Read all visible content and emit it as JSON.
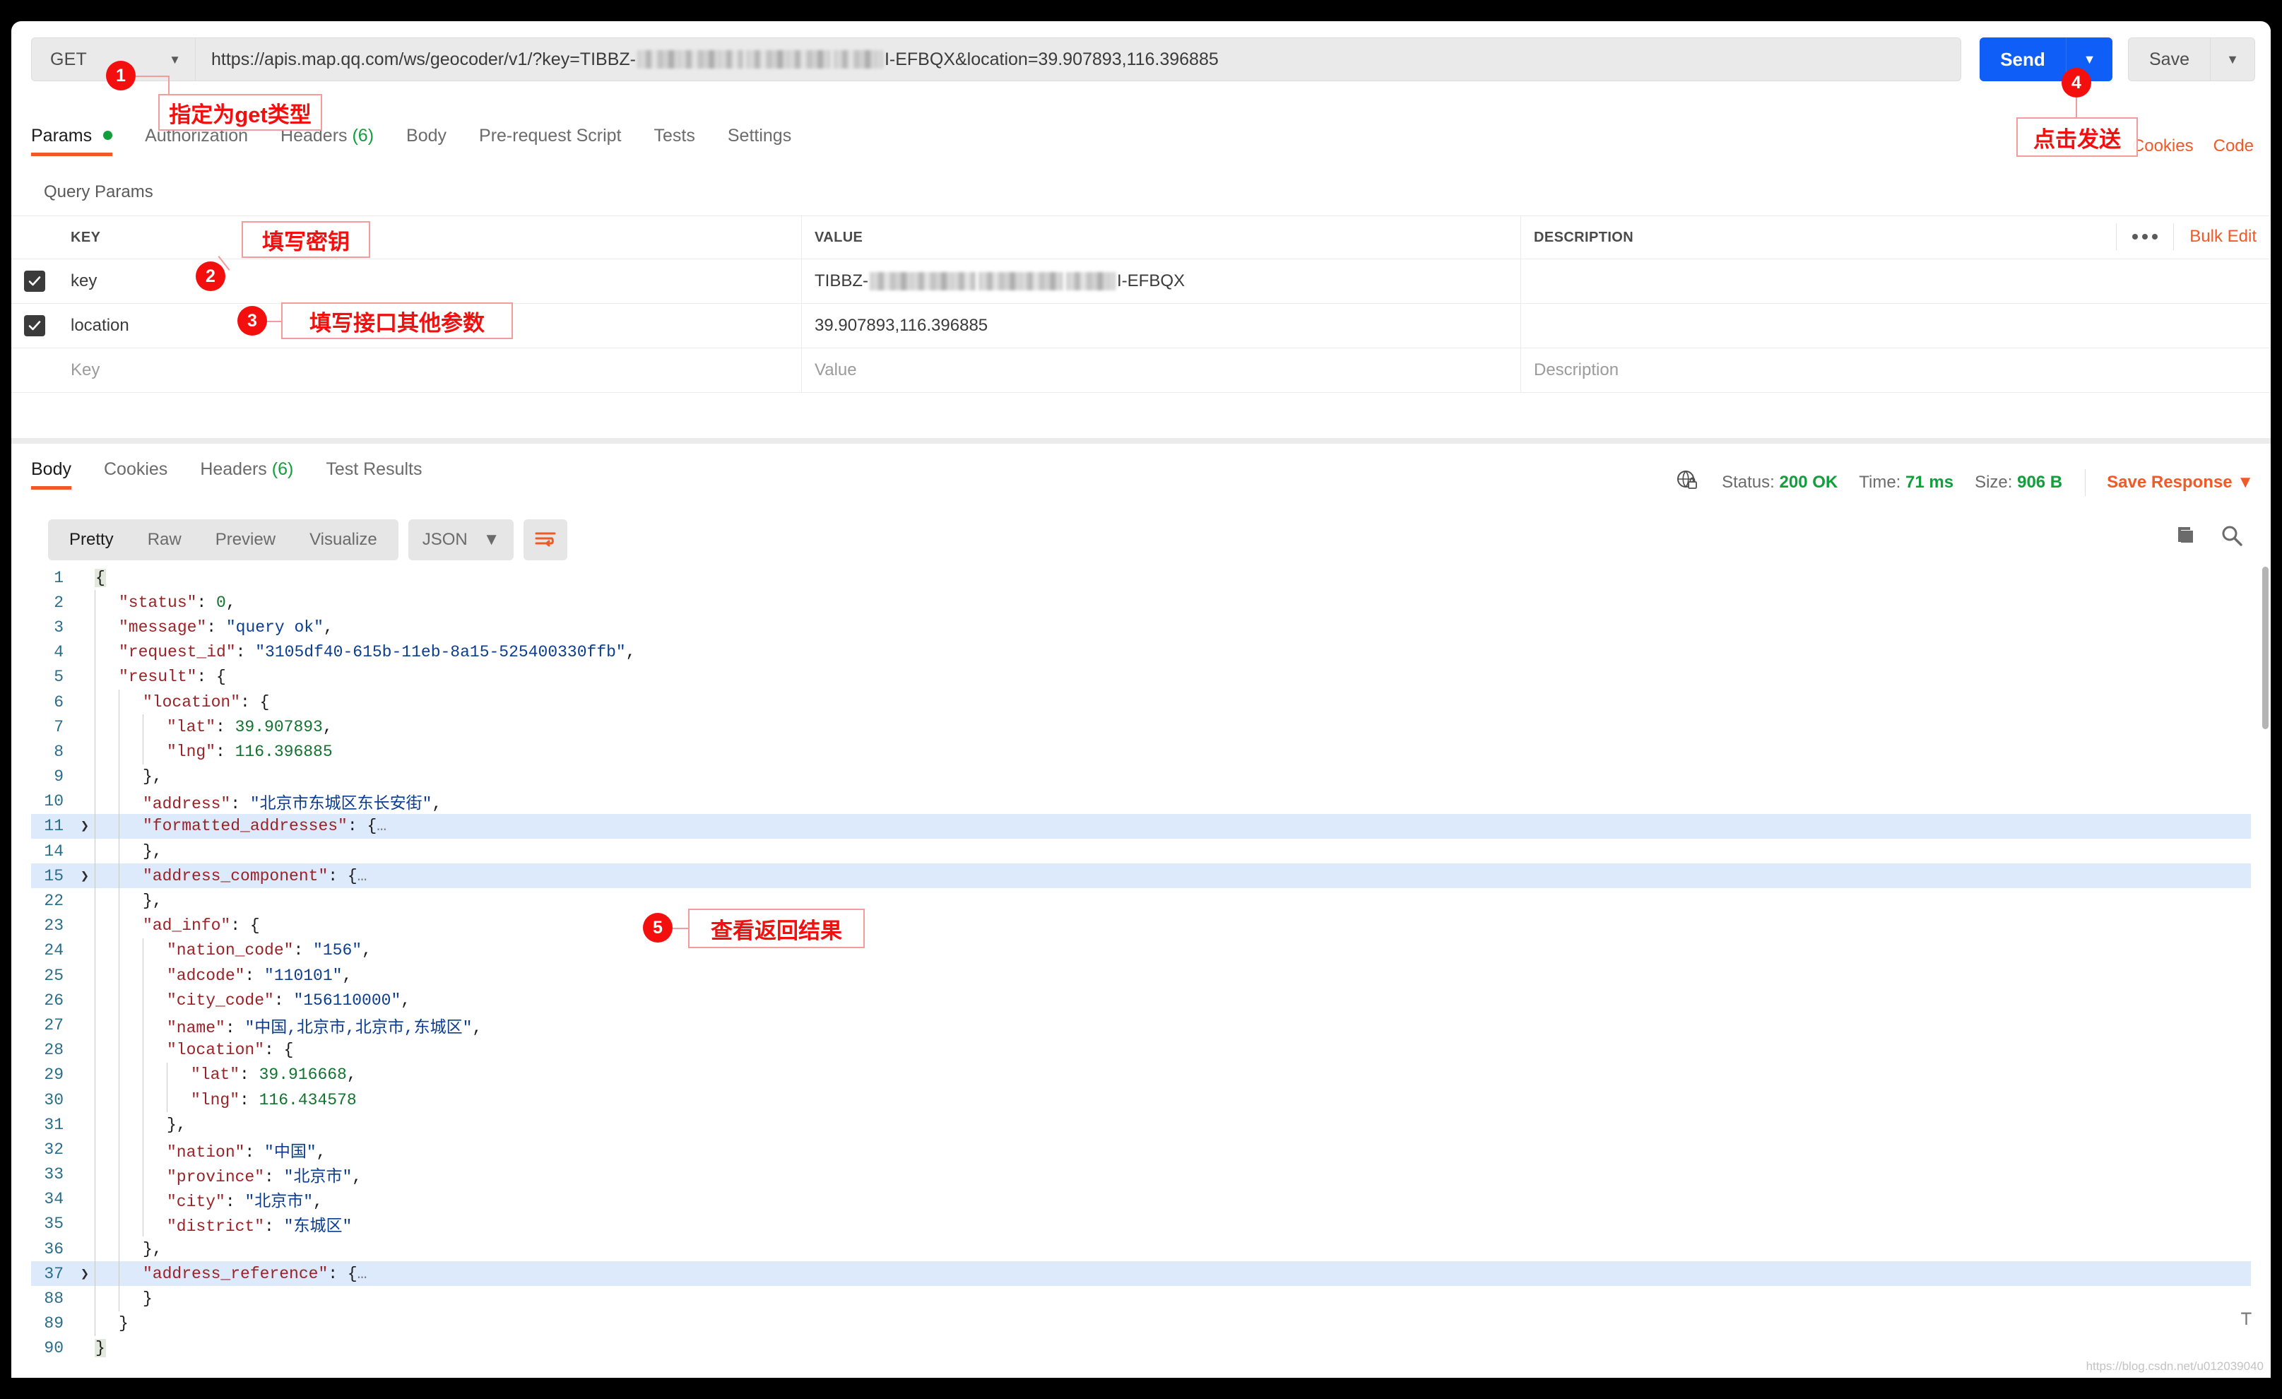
{
  "request": {
    "method": "GET",
    "url_prefix": "https://apis.map.qq.com/ws/geocoder/v1/?key=TIBBZ-",
    "url_suffix": "I-EFBQX&location=39.907893,116.396885",
    "send_label": "Send",
    "save_label": "Save",
    "tabs": [
      {
        "label": "Params",
        "active": true,
        "indicator": "dot"
      },
      {
        "label": "Authorization",
        "active": false
      },
      {
        "label": "Headers",
        "active": false,
        "count": "(6)"
      },
      {
        "label": "Body",
        "active": false
      },
      {
        "label": "Pre-request Script",
        "active": false
      },
      {
        "label": "Tests",
        "active": false
      },
      {
        "label": "Settings",
        "active": false
      }
    ],
    "right_links": [
      "Cookies",
      "Code"
    ]
  },
  "query_params": {
    "section_title": "Query Params",
    "columns": [
      "KEY",
      "VALUE",
      "DESCRIPTION"
    ],
    "rows": [
      {
        "checked": true,
        "key": "key",
        "value_prefix": "TIBBZ-",
        "value_suffix": "I-EFBQX",
        "redacted": true,
        "description": ""
      },
      {
        "checked": true,
        "key": "location",
        "value": "39.907893,116.396885",
        "description": ""
      }
    ],
    "placeholder_row": {
      "key": "Key",
      "value": "Value",
      "description": "Description"
    },
    "bulk_edit_label": "Bulk Edit"
  },
  "response": {
    "tabs": [
      {
        "label": "Body",
        "active": true
      },
      {
        "label": "Cookies",
        "active": false
      },
      {
        "label": "Headers",
        "active": false,
        "count": "(6)"
      },
      {
        "label": "Test Results",
        "active": false
      }
    ],
    "status_label": "Status:",
    "status_value": "200 OK",
    "time_label": "Time:",
    "time_value": "71 ms",
    "size_label": "Size:",
    "size_value": "906 B",
    "save_response_label": "Save Response",
    "view_modes": [
      {
        "label": "Pretty",
        "active": true
      },
      {
        "label": "Raw",
        "active": false
      },
      {
        "label": "Preview",
        "active": false
      },
      {
        "label": "Visualize",
        "active": false
      }
    ],
    "format": "JSON"
  },
  "code": {
    "lines": [
      {
        "n": "1",
        "indent": 0,
        "fold": "",
        "hl": false,
        "cur": true,
        "tokens": [
          {
            "t": "pun",
            "v": "{"
          }
        ]
      },
      {
        "n": "2",
        "indent": 1,
        "fold": "",
        "hl": false,
        "tokens": [
          {
            "t": "key",
            "v": "\"status\""
          },
          {
            "t": "pun",
            "v": ": "
          },
          {
            "t": "num",
            "v": "0"
          },
          {
            "t": "pun",
            "v": ","
          }
        ]
      },
      {
        "n": "3",
        "indent": 1,
        "fold": "",
        "hl": false,
        "tokens": [
          {
            "t": "key",
            "v": "\"message\""
          },
          {
            "t": "pun",
            "v": ": "
          },
          {
            "t": "str",
            "v": "\"query ok\""
          },
          {
            "t": "pun",
            "v": ","
          }
        ]
      },
      {
        "n": "4",
        "indent": 1,
        "fold": "",
        "hl": false,
        "tokens": [
          {
            "t": "key",
            "v": "\"request_id\""
          },
          {
            "t": "pun",
            "v": ": "
          },
          {
            "t": "str",
            "v": "\"3105df40-615b-11eb-8a15-525400330ffb\""
          },
          {
            "t": "pun",
            "v": ","
          }
        ]
      },
      {
        "n": "5",
        "indent": 1,
        "fold": "",
        "hl": false,
        "tokens": [
          {
            "t": "key",
            "v": "\"result\""
          },
          {
            "t": "pun",
            "v": ": {"
          }
        ]
      },
      {
        "n": "6",
        "indent": 2,
        "fold": "",
        "hl": false,
        "tokens": [
          {
            "t": "key",
            "v": "\"location\""
          },
          {
            "t": "pun",
            "v": ": {"
          }
        ]
      },
      {
        "n": "7",
        "indent": 3,
        "fold": "",
        "hl": false,
        "tokens": [
          {
            "t": "key",
            "v": "\"lat\""
          },
          {
            "t": "pun",
            "v": ": "
          },
          {
            "t": "num",
            "v": "39.907893"
          },
          {
            "t": "pun",
            "v": ","
          }
        ]
      },
      {
        "n": "8",
        "indent": 3,
        "fold": "",
        "hl": false,
        "tokens": [
          {
            "t": "key",
            "v": "\"lng\""
          },
          {
            "t": "pun",
            "v": ": "
          },
          {
            "t": "num",
            "v": "116.396885"
          }
        ]
      },
      {
        "n": "9",
        "indent": 2,
        "fold": "",
        "hl": false,
        "tokens": [
          {
            "t": "pun",
            "v": "},"
          }
        ]
      },
      {
        "n": "10",
        "indent": 2,
        "fold": "",
        "hl": false,
        "tokens": [
          {
            "t": "key",
            "v": "\"address\""
          },
          {
            "t": "pun",
            "v": ": "
          },
          {
            "t": "str",
            "v": "\"北京市东城区东长安街\""
          },
          {
            "t": "pun",
            "v": ","
          }
        ]
      },
      {
        "n": "11",
        "indent": 2,
        "fold": "❯",
        "hl": true,
        "tokens": [
          {
            "t": "key",
            "v": "\"formatted_addresses\""
          },
          {
            "t": "pun",
            "v": ": {"
          },
          {
            "t": "ell",
            "v": "…"
          }
        ]
      },
      {
        "n": "14",
        "indent": 2,
        "fold": "",
        "hl": false,
        "tokens": [
          {
            "t": "pun",
            "v": "},"
          }
        ]
      },
      {
        "n": "15",
        "indent": 2,
        "fold": "❯",
        "hl": true,
        "tokens": [
          {
            "t": "key",
            "v": "\"address_component\""
          },
          {
            "t": "pun",
            "v": ": {"
          },
          {
            "t": "ell",
            "v": "…"
          }
        ]
      },
      {
        "n": "22",
        "indent": 2,
        "fold": "",
        "hl": false,
        "tokens": [
          {
            "t": "pun",
            "v": "},"
          }
        ]
      },
      {
        "n": "23",
        "indent": 2,
        "fold": "",
        "hl": false,
        "tokens": [
          {
            "t": "key",
            "v": "\"ad_info\""
          },
          {
            "t": "pun",
            "v": ": {"
          }
        ]
      },
      {
        "n": "24",
        "indent": 3,
        "fold": "",
        "hl": false,
        "tokens": [
          {
            "t": "key",
            "v": "\"nation_code\""
          },
          {
            "t": "pun",
            "v": ": "
          },
          {
            "t": "str",
            "v": "\"156\""
          },
          {
            "t": "pun",
            "v": ","
          }
        ]
      },
      {
        "n": "25",
        "indent": 3,
        "fold": "",
        "hl": false,
        "tokens": [
          {
            "t": "key",
            "v": "\"adcode\""
          },
          {
            "t": "pun",
            "v": ": "
          },
          {
            "t": "str",
            "v": "\"110101\""
          },
          {
            "t": "pun",
            "v": ","
          }
        ]
      },
      {
        "n": "26",
        "indent": 3,
        "fold": "",
        "hl": false,
        "tokens": [
          {
            "t": "key",
            "v": "\"city_code\""
          },
          {
            "t": "pun",
            "v": ": "
          },
          {
            "t": "str",
            "v": "\"156110000\""
          },
          {
            "t": "pun",
            "v": ","
          }
        ]
      },
      {
        "n": "27",
        "indent": 3,
        "fold": "",
        "hl": false,
        "tokens": [
          {
            "t": "key",
            "v": "\"name\""
          },
          {
            "t": "pun",
            "v": ": "
          },
          {
            "t": "str",
            "v": "\"中国,北京市,北京市,东城区\""
          },
          {
            "t": "pun",
            "v": ","
          }
        ]
      },
      {
        "n": "28",
        "indent": 3,
        "fold": "",
        "hl": false,
        "tokens": [
          {
            "t": "key",
            "v": "\"location\""
          },
          {
            "t": "pun",
            "v": ": {"
          }
        ]
      },
      {
        "n": "29",
        "indent": 4,
        "fold": "",
        "hl": false,
        "tokens": [
          {
            "t": "key",
            "v": "\"lat\""
          },
          {
            "t": "pun",
            "v": ": "
          },
          {
            "t": "num",
            "v": "39.916668"
          },
          {
            "t": "pun",
            "v": ","
          }
        ]
      },
      {
        "n": "30",
        "indent": 4,
        "fold": "",
        "hl": false,
        "tokens": [
          {
            "t": "key",
            "v": "\"lng\""
          },
          {
            "t": "pun",
            "v": ": "
          },
          {
            "t": "num",
            "v": "116.434578"
          }
        ]
      },
      {
        "n": "31",
        "indent": 3,
        "fold": "",
        "hl": false,
        "tokens": [
          {
            "t": "pun",
            "v": "},"
          }
        ]
      },
      {
        "n": "32",
        "indent": 3,
        "fold": "",
        "hl": false,
        "tokens": [
          {
            "t": "key",
            "v": "\"nation\""
          },
          {
            "t": "pun",
            "v": ": "
          },
          {
            "t": "str",
            "v": "\"中国\""
          },
          {
            "t": "pun",
            "v": ","
          }
        ]
      },
      {
        "n": "33",
        "indent": 3,
        "fold": "",
        "hl": false,
        "tokens": [
          {
            "t": "key",
            "v": "\"province\""
          },
          {
            "t": "pun",
            "v": ": "
          },
          {
            "t": "str",
            "v": "\"北京市\""
          },
          {
            "t": "pun",
            "v": ","
          }
        ]
      },
      {
        "n": "34",
        "indent": 3,
        "fold": "",
        "hl": false,
        "tokens": [
          {
            "t": "key",
            "v": "\"city\""
          },
          {
            "t": "pun",
            "v": ": "
          },
          {
            "t": "str",
            "v": "\"北京市\""
          },
          {
            "t": "pun",
            "v": ","
          }
        ]
      },
      {
        "n": "35",
        "indent": 3,
        "fold": "",
        "hl": false,
        "tokens": [
          {
            "t": "key",
            "v": "\"district\""
          },
          {
            "t": "pun",
            "v": ": "
          },
          {
            "t": "str",
            "v": "\"东城区\""
          }
        ]
      },
      {
        "n": "36",
        "indent": 2,
        "fold": "",
        "hl": false,
        "tokens": [
          {
            "t": "pun",
            "v": "},"
          }
        ]
      },
      {
        "n": "37",
        "indent": 2,
        "fold": "❯",
        "hl": true,
        "tokens": [
          {
            "t": "key",
            "v": "\"address_reference\""
          },
          {
            "t": "pun",
            "v": ": {"
          },
          {
            "t": "ell",
            "v": "…"
          }
        ]
      },
      {
        "n": "88",
        "indent": 2,
        "fold": "",
        "hl": false,
        "tokens": [
          {
            "t": "pun",
            "v": "}"
          }
        ]
      },
      {
        "n": "89",
        "indent": 1,
        "fold": "",
        "hl": false,
        "tokens": [
          {
            "t": "pun",
            "v": "}"
          }
        ]
      },
      {
        "n": "90",
        "indent": 0,
        "fold": "",
        "hl": false,
        "cur": true,
        "tokens": [
          {
            "t": "pun",
            "v": "}"
          }
        ]
      }
    ]
  },
  "annotations": [
    {
      "num": "1",
      "text": "指定为get类型"
    },
    {
      "num": "2",
      "text": "填写密钥"
    },
    {
      "num": "3",
      "text": "填写接口其他参数"
    },
    {
      "num": "4",
      "text": "点击发送"
    },
    {
      "num": "5",
      "text": "查看返回结果"
    }
  ],
  "watermark": "https://blog.csdn.net/u012039040"
}
